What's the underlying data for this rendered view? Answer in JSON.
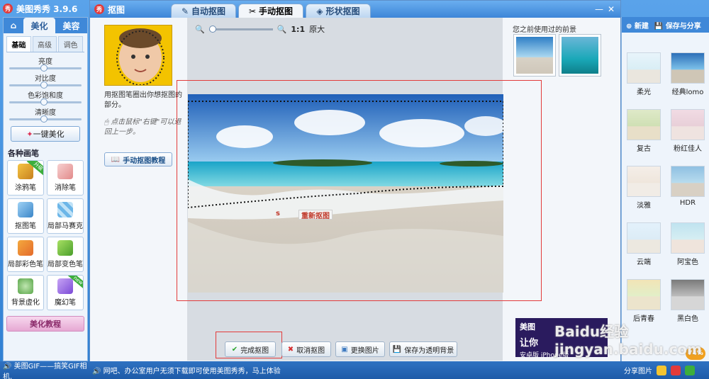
{
  "app": {
    "title": "美图秀秀 3.9.6",
    "tabs": [
      "美化",
      "美容"
    ],
    "subtabs": [
      "基础",
      "高级",
      "调色"
    ],
    "sliders": [
      "亮度",
      "对比度",
      "色彩饱和度",
      "清晰度"
    ],
    "one_key_label": "一键美化",
    "brush_section_title": "各种画笔",
    "brushes": [
      {
        "label": "涂鸦笔",
        "badge": "升级"
      },
      {
        "label": "消除笔"
      },
      {
        "label": "抠图笔"
      },
      {
        "label": "局部马赛克"
      },
      {
        "label": "局部彩色笔"
      },
      {
        "label": "局部变色笔"
      },
      {
        "label": "背景虚化"
      },
      {
        "label": "魔幻笔",
        "badge": "new"
      }
    ],
    "tutorial_label": "美化教程"
  },
  "dialog": {
    "title": "抠图",
    "tabs": [
      "自动抠图",
      "手动抠图",
      "形状抠图"
    ],
    "active_tab": "手动抠图",
    "hint": "用抠图笔圈出你想抠图的部分。",
    "hint2": "点击鼠标\"右键\"可以退回上一步。",
    "tutorial_link": "手动抠图教程",
    "zoom_text": "1:1",
    "zoom_suffix": "原大",
    "recent_label": "您之前使用过的前景",
    "reset_label": "重新抠图",
    "reset_partial": "s",
    "buttons": {
      "finish": "完成抠图",
      "cancel": "取消抠图",
      "change": "更换图片",
      "save_transparent": "保存为透明背景"
    },
    "ad_line1": "美图",
    "ad_line2": "让你",
    "ad_line3": "安卓版 iPhone版",
    "colors": {
      "accent": "#3f88d8",
      "highlight": "#e23b3b"
    }
  },
  "right_panel": {
    "new_label": "新建",
    "save_share_label": "保存与分享",
    "filters": [
      "柔光",
      "经典lomo",
      "复古",
      "粉红佳人",
      "淡雅",
      "HDR",
      "云端",
      "阿宝色",
      "后青春",
      "黑白色"
    ],
    "share_label": "分享图片",
    "percent": "74%"
  },
  "status": {
    "left_text": "美图GIF——搞笑GIF相机,",
    "mid_text": "网吧、办公室用户无须下载即可使用美图秀秀，马上体验"
  },
  "watermark": "Baidu经验 jingyan.baidu.com"
}
